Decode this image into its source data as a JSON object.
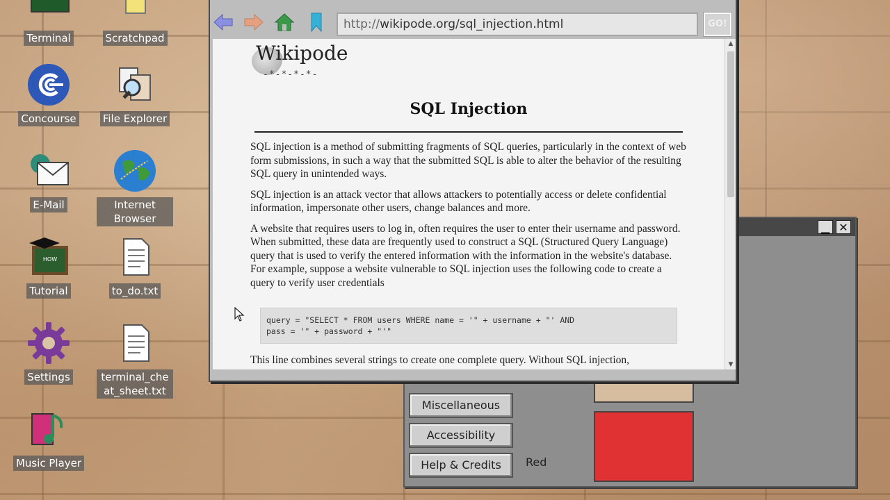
{
  "desktop": {
    "icons": [
      {
        "label": "Terminal",
        "icon": "terminal-icon"
      },
      {
        "label": "Scratchpad",
        "icon": "scratchpad-icon"
      },
      {
        "label": "Concourse",
        "icon": "concourse-icon"
      },
      {
        "label": "File Explorer",
        "icon": "file-explorer-icon"
      },
      {
        "label": "E-Mail",
        "icon": "email-icon"
      },
      {
        "label": "Internet Browser",
        "icon": "globe-icon"
      },
      {
        "label": "Tutorial",
        "icon": "tutorial-icon"
      },
      {
        "label": "to_do.txt",
        "icon": "text-file-icon"
      },
      {
        "label": "Settings",
        "icon": "gear-icon"
      },
      {
        "label": "terminal_cheat_sheet.txt",
        "icon": "text-file-icon"
      },
      {
        "label": "Music Player",
        "icon": "music-icon"
      }
    ]
  },
  "settings_window": {
    "buttons": [
      "Miscellaneous",
      "Accessibility",
      "Help & Credits"
    ],
    "color_label": "Red",
    "swatch_color": "#e03232"
  },
  "browser": {
    "url_protocol": "http://",
    "url_path": "wikipode.org/sql_injection.html",
    "go_label": "GO!",
    "logo": {
      "name": "Wikipode",
      "tagline": "-*-*-*-*-"
    },
    "article": {
      "title": "SQL Injection",
      "paragraphs": [
        "SQL injection is a method of submitting fragments of SQL queries, particularly in the context of web form submissions, in such a way that the submitted SQL is able to alter the behavior of the resulting SQL query in unintended ways.",
        "SQL injection is an attack vector that allows attackers to potentially access or delete confidential information, impersonate other users, change balances and more.",
        "A website that requires users to log in, often requires the user to enter their username and password. When submitted, these data are frequently used to construct a SQL (Structured Query Language) query that is used to verify the entered information with the information in the website's database. For example, suppose a website vulnerable to SQL injection uses the following code to create a query to verify user credentials"
      ],
      "code": "query = \"SELECT * FROM users WHERE name = '\" + username + \"' AND\npass = '\" + password + \"'\"",
      "trailing": "This line combines several strings to create one complete query. Without SQL injection,"
    }
  }
}
